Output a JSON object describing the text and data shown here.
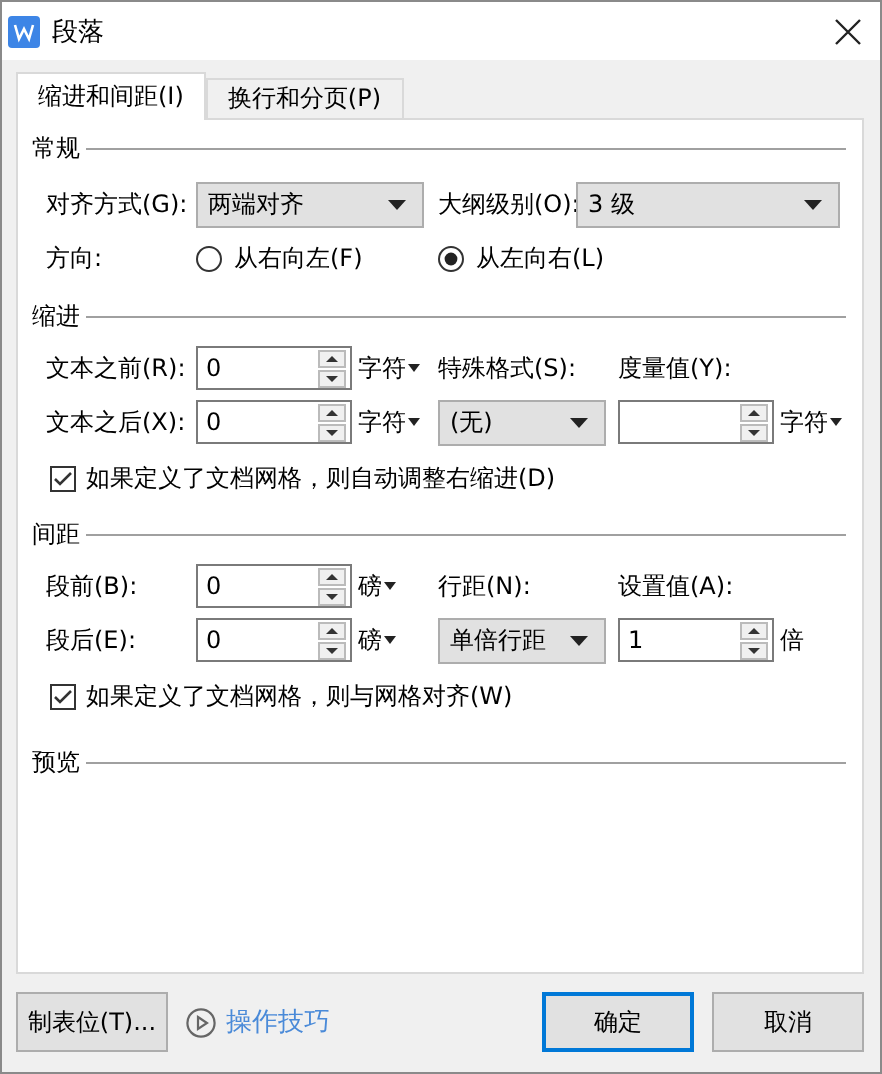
{
  "window": {
    "title": "段落"
  },
  "tabs": [
    {
      "label": "缩进和间距(I)",
      "selected": true
    },
    {
      "label": "换行和分页(P)",
      "selected": false
    }
  ],
  "general": {
    "heading": "常规",
    "alignment": {
      "label": "对齐方式(G):",
      "value": "两端对齐"
    },
    "outline_level": {
      "label": "大纲级别(O):",
      "value": "3 级"
    },
    "direction": {
      "label": "方向:",
      "options": [
        {
          "label": "从右向左(F)",
          "selected": false
        },
        {
          "label": "从左向右(L)",
          "selected": true
        }
      ]
    }
  },
  "indent": {
    "heading": "缩进",
    "before": {
      "label": "文本之前(R):",
      "value": "0",
      "unit": "字符",
      "unit_menu": true
    },
    "after": {
      "label": "文本之后(X):",
      "value": "0",
      "unit": "字符",
      "unit_menu": true
    },
    "special": {
      "label": "特殊格式(S):",
      "value": "(无)"
    },
    "measure": {
      "label": "度量值(Y):",
      "unit": "字符",
      "unit_menu": true
    },
    "grid_check": {
      "label": "如果定义了文档网格，则自动调整右缩进(D)",
      "checked": true
    }
  },
  "spacing": {
    "heading": "间距",
    "before": {
      "label": "段前(B):",
      "value": "0",
      "unit": "磅",
      "unit_menu": true
    },
    "after": {
      "label": "段后(E):",
      "value": "0",
      "unit": "磅",
      "unit_menu": true
    },
    "line_spacing": {
      "label": "行距(N):",
      "value": "单倍行距"
    },
    "set_value": {
      "label": "设置值(A):",
      "value": "1",
      "unit": "倍",
      "unit_menu": false
    },
    "grid_check": {
      "label": "如果定义了文档网格，则与网格对齐(W)",
      "checked": true
    }
  },
  "preview": {
    "heading": "预览"
  },
  "footer": {
    "tab_stops": "制表位(T)...",
    "tips": "操作技巧",
    "ok": "确定",
    "cancel": "取消"
  }
}
